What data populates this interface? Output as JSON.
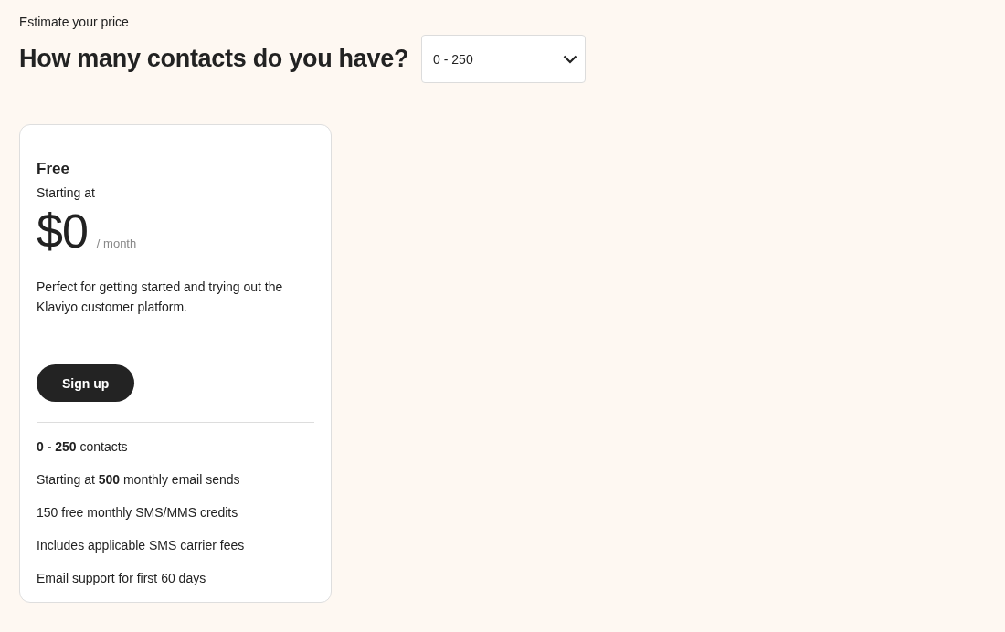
{
  "eyebrow": "Estimate your price",
  "question": "How many contacts do you have?",
  "contacts_dropdown": {
    "value": "0 - 250"
  },
  "plan": {
    "name": "Free",
    "starting_label": "Starting at",
    "price": "$0",
    "period": "/ month",
    "description": "Perfect for getting started and trying out the Klaviyo customer platform.",
    "button": "Sign up",
    "features": [
      "**0 - 250** contacts",
      "Starting at **500** monthly email sends",
      "150 free monthly SMS/MMS credits",
      "Includes applicable SMS carrier fees",
      "Email support for first 60 days"
    ]
  }
}
